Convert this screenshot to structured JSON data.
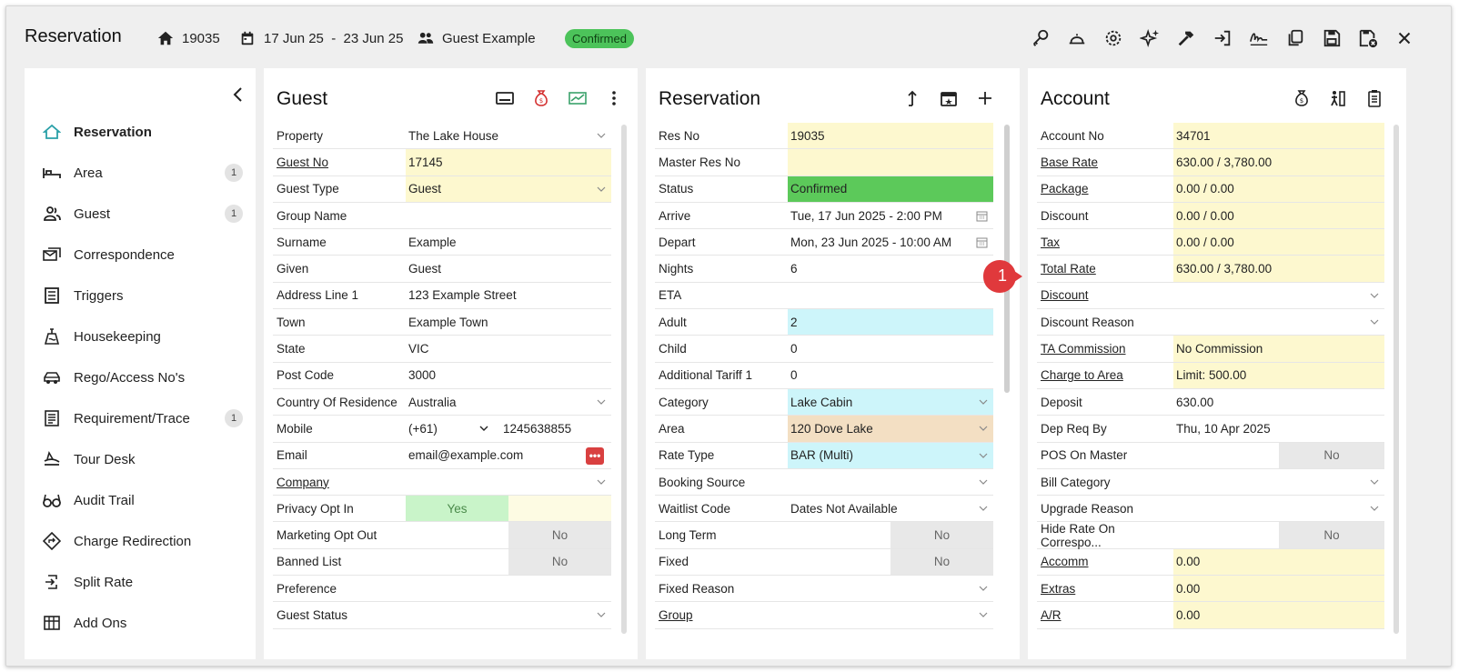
{
  "header": {
    "title": "Reservation",
    "res_no": "19035",
    "dates": "17 Jun 25  -  23 Jun 25",
    "guest": "Guest Example",
    "status": "Confirmed"
  },
  "toolbar_icons": [
    "key-icon",
    "bell-icon",
    "gear-icon",
    "sparkle-icon",
    "hammer-icon",
    "sign-in-icon",
    "signature-icon",
    "copy-icon",
    "save-icon",
    "save-close-icon",
    "close-icon"
  ],
  "sidebar": {
    "items": [
      {
        "label": "Reservation",
        "icon": "home-icon",
        "badge": ""
      },
      {
        "label": "Area",
        "icon": "bed-icon",
        "badge": "1"
      },
      {
        "label": "Guest",
        "icon": "users-icon",
        "badge": "1"
      },
      {
        "label": "Correspondence",
        "icon": "mail-icon",
        "badge": ""
      },
      {
        "label": "Triggers",
        "icon": "list-icon",
        "badge": ""
      },
      {
        "label": "Housekeeping",
        "icon": "clean-icon",
        "badge": ""
      },
      {
        "label": "Rego/Access No's",
        "icon": "car-icon",
        "badge": ""
      },
      {
        "label": "Requirement/Trace",
        "icon": "checklist-icon",
        "badge": "1"
      },
      {
        "label": "Tour Desk",
        "icon": "tour-icon",
        "badge": ""
      },
      {
        "label": "Audit Trail",
        "icon": "glasses-icon",
        "badge": ""
      },
      {
        "label": "Charge Redirection",
        "icon": "redirect-icon",
        "badge": ""
      },
      {
        "label": "Split Rate",
        "icon": "split-icon",
        "badge": ""
      },
      {
        "label": "Add Ons",
        "icon": "grid-icon",
        "badge": ""
      }
    ]
  },
  "guest_panel": {
    "title": "Guest",
    "rows": [
      {
        "label": "Property",
        "value": "The Lake House",
        "dropdown": true
      },
      {
        "label": "Guest No",
        "value": "17145",
        "link": true,
        "color": "yellow"
      },
      {
        "label": "Guest Type",
        "value": "Guest",
        "dropdown": true,
        "color": "yellow"
      },
      {
        "label": "Group Name",
        "value": ""
      },
      {
        "label": "Surname",
        "value": "Example"
      },
      {
        "label": "Given",
        "value": "Guest"
      },
      {
        "label": "Address Line 1",
        "value": "123 Example Street"
      },
      {
        "label": "Town",
        "value": "Example Town"
      },
      {
        "label": "State",
        "value": "VIC"
      },
      {
        "label": "Post Code",
        "value": "3000"
      },
      {
        "label": "Country Of Residence",
        "value": "Australia",
        "dropdown": true
      },
      {
        "label": "Mobile",
        "value": "1245638855",
        "prefix": "(+61)"
      },
      {
        "label": "Email",
        "value": "email@example.com",
        "email": true
      },
      {
        "label": "Company",
        "value": "",
        "link": true,
        "dropdown": true
      },
      {
        "label": "Privacy Opt In",
        "toggle": "Yes",
        "state": "on"
      },
      {
        "label": "Marketing Opt Out",
        "toggle": "No",
        "state": "off"
      },
      {
        "label": "Banned List",
        "toggle": "No",
        "state": "off"
      },
      {
        "label": "Preference",
        "value": ""
      },
      {
        "label": "Guest Status",
        "value": "",
        "dropdown": true
      }
    ]
  },
  "reservation_panel": {
    "title": "Reservation",
    "rows": [
      {
        "label": "Res No",
        "value": "19035",
        "color": "yellow"
      },
      {
        "label": "Master Res No",
        "value": "",
        "color": "yellow"
      },
      {
        "label": "Status",
        "value": "Confirmed",
        "color": "green"
      },
      {
        "label": "Arrive",
        "value": "Tue, 17 Jun 2025 - 2:00 PM",
        "calendar": true
      },
      {
        "label": "Depart",
        "value": "Mon, 23 Jun 2025 - 10:00 AM",
        "calendar": true
      },
      {
        "label": "Nights",
        "value": "6"
      },
      {
        "label": "ETA",
        "value": ""
      },
      {
        "label": "Adult",
        "value": "2",
        "color": "cyan"
      },
      {
        "label": "Child",
        "value": "0"
      },
      {
        "label": "Additional Tariff 1",
        "value": "0"
      },
      {
        "label": "Category",
        "value": "Lake Cabin",
        "color": "cyan",
        "dropdown": true,
        "filter": true
      },
      {
        "label": "Area",
        "value": "120 Dove Lake",
        "color": "tan",
        "dropdown": true,
        "filter": true
      },
      {
        "label": "Rate Type",
        "value": "BAR (Multi)",
        "color": "cyan",
        "dropdown": true
      },
      {
        "label": "Booking Source",
        "value": "",
        "dropdown": true
      },
      {
        "label": "Waitlist Code",
        "value": "Dates Not Available",
        "dropdown": true
      },
      {
        "label": "Long Term",
        "toggle": "No",
        "state": "off"
      },
      {
        "label": "Fixed",
        "toggle": "No",
        "state": "off"
      },
      {
        "label": "Fixed Reason",
        "value": "",
        "dropdown": true
      },
      {
        "label": "Group",
        "value": "",
        "link": true,
        "dropdown": true
      }
    ]
  },
  "account_panel": {
    "title": "Account",
    "rows": [
      {
        "label": "Account No",
        "value": "34701",
        "color": "yellow"
      },
      {
        "label": "Base Rate",
        "value": "630.00 / 3,780.00",
        "link": true,
        "color": "yellow"
      },
      {
        "label": "Package",
        "value": "0.00 / 0.00",
        "link": true,
        "color": "yellow"
      },
      {
        "label": "Discount",
        "value": "0.00 / 0.00",
        "color": "yellow"
      },
      {
        "label": "Tax",
        "value": "0.00 / 0.00",
        "link": true,
        "color": "yellow"
      },
      {
        "label": "Total Rate",
        "value": "630.00 / 3,780.00",
        "link": true,
        "color": "yellow"
      },
      {
        "label": "Discount",
        "value": "",
        "link": true,
        "dropdown": true
      },
      {
        "label": "Discount Reason",
        "value": "",
        "dropdown": true
      },
      {
        "label": "TA Commission",
        "value": "No Commission",
        "link": true,
        "color": "yellow"
      },
      {
        "label": "Charge to Area",
        "value": "Limit: 500.00",
        "link": true,
        "color": "yellow"
      },
      {
        "label": "Deposit",
        "value": "630.00"
      },
      {
        "label": "Dep Req By",
        "value": "Thu, 10 Apr 2025"
      },
      {
        "label": "POS On Master",
        "toggle": "No",
        "state": "off"
      },
      {
        "label": "Bill Category",
        "value": "",
        "dropdown": true
      },
      {
        "label": "Upgrade Reason",
        "value": "",
        "dropdown": true
      },
      {
        "label": "Hide Rate On Correspo...",
        "toggle": "No",
        "state": "off"
      },
      {
        "label": "Accomm",
        "value": "0.00",
        "link": true,
        "color": "yellow"
      },
      {
        "label": "Extras",
        "value": "0.00",
        "link": true,
        "color": "yellow"
      },
      {
        "label": "A/R",
        "value": "0.00",
        "link": true,
        "color": "yellow"
      }
    ]
  },
  "callout": {
    "number": "1"
  }
}
